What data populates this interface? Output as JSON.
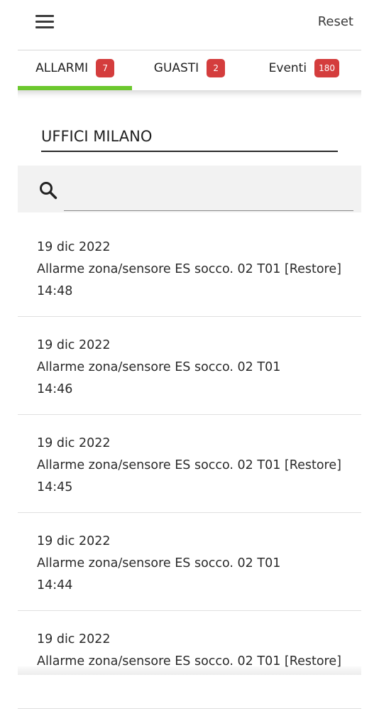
{
  "header": {
    "menu_icon": "hamburger-menu-icon",
    "reset_label": "Reset"
  },
  "tabs": [
    {
      "label": "ALLARMI",
      "badge": "7",
      "active": true
    },
    {
      "label": "GUASTI",
      "badge": "2",
      "active": false
    },
    {
      "label": "Eventi",
      "badge": "180",
      "active": false
    }
  ],
  "site": {
    "name": "UFFICI MILANO"
  },
  "search": {
    "icon": "search-icon",
    "value": ""
  },
  "events": [
    {
      "date": "19 dic 2022",
      "description": "Allarme zona/sensore ES socco. 02 T01 [Restore]",
      "time": "14:48"
    },
    {
      "date": "19 dic 2022",
      "description": "Allarme zona/sensore ES socco. 02 T01",
      "time": "14:46"
    },
    {
      "date": "19 dic 2022",
      "description": "Allarme zona/sensore ES socco. 02 T01 [Restore]",
      "time": "14:45"
    },
    {
      "date": "19 dic 2022",
      "description": "Allarme zona/sensore ES socco. 02 T01",
      "time": "14:44"
    },
    {
      "date": "19 dic 2022",
      "description": "Allarme zona/sensore ES socco. 02 T01 [Restore]",
      "time": ""
    }
  ],
  "colors": {
    "badge": "#d43d3d",
    "active_tab_underline": "#6cc82e",
    "search_background": "#f2f2f2"
  }
}
